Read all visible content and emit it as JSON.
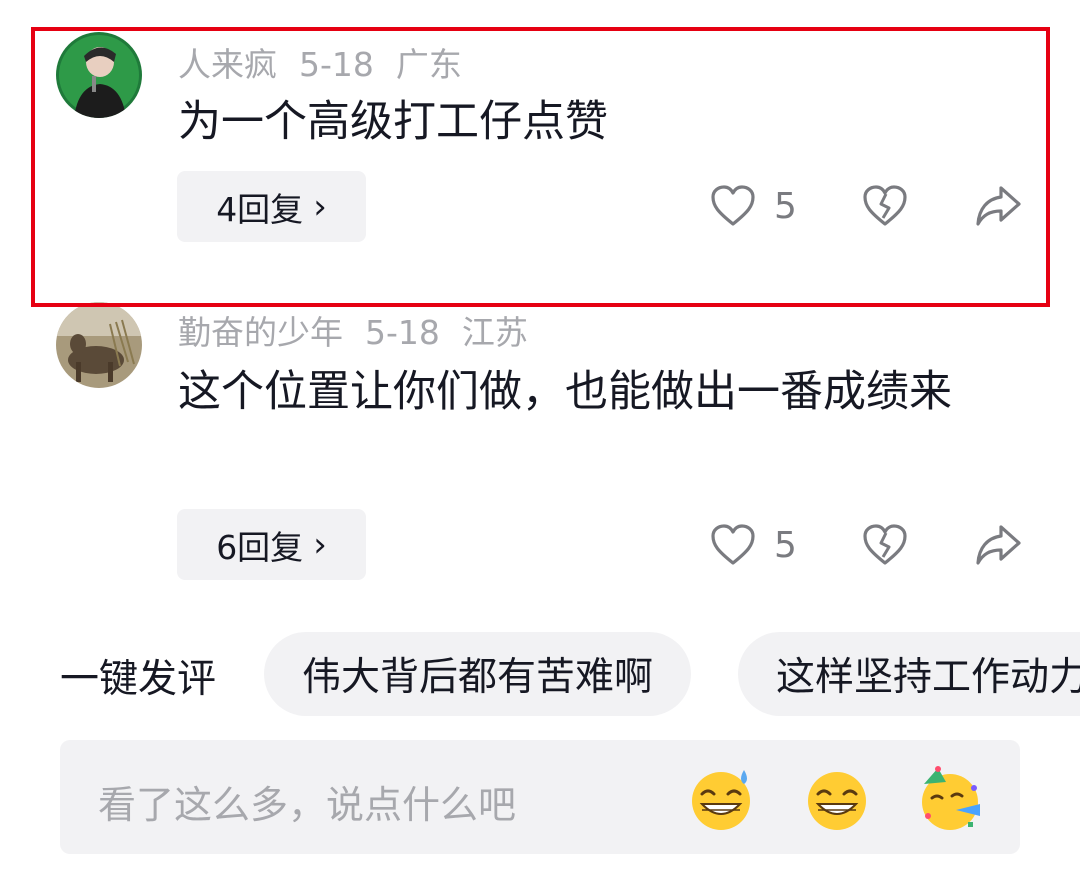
{
  "comments": [
    {
      "username": "人来疯",
      "date": "5-18",
      "location": "广东",
      "text": "为一个高级打工仔点赞",
      "reply_label": "4回复",
      "likes": "5"
    },
    {
      "username": "勤奋的少年",
      "date": "5-18",
      "location": "江苏",
      "text": "这个位置让你们做，也能做出一番成绩来",
      "reply_label": "6回复",
      "likes": "5"
    }
  ],
  "quick_comment": {
    "label": "一键发评",
    "chips": [
      "伟大背后都有苦难啊",
      "这样坚持工作动力"
    ]
  },
  "input": {
    "placeholder": "看了这么多，说点什么吧",
    "emojis": [
      "grin-sweat-emoji",
      "grin-emoji",
      "party-emoji"
    ]
  },
  "colors": {
    "highlight": "#e60012",
    "meta_text": "#a7a8ad",
    "chip_bg": "#f2f2f4"
  }
}
